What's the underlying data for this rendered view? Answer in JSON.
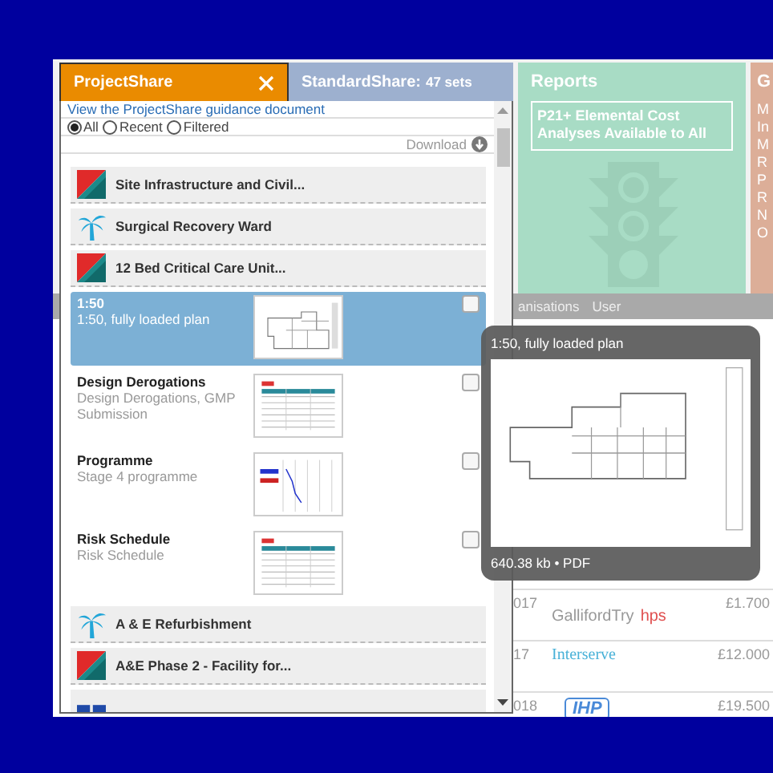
{
  "tabs": [
    {
      "label": "ProjectShare",
      "selected": true,
      "closable": true
    },
    {
      "label": "StandardShare:",
      "count": "47 sets",
      "selected": false,
      "closable": false
    }
  ],
  "guidance_link": "View the ProjectShare guidance document",
  "filters": [
    {
      "label": "All",
      "selected": true
    },
    {
      "label": "Recent",
      "selected": false
    },
    {
      "label": "Filtered",
      "selected": false
    }
  ],
  "download": "Download",
  "entries": [
    {
      "kind": "flag",
      "title": "Site Infrastructure and Civil..."
    },
    {
      "kind": "tree",
      "title": "Surgical Recovery Ward"
    },
    {
      "kind": "flag",
      "title": "12 Bed Critical Care Unit..."
    },
    {
      "kind": "document",
      "title": "1:50",
      "subtitle": "1:50, fully loaded plan",
      "selected": true,
      "checked": false
    },
    {
      "kind": "document",
      "title": "Design Derogations",
      "subtitle": "Design Derogations, GMP Submission",
      "selected": false,
      "checked": false
    },
    {
      "kind": "document",
      "title": "Programme",
      "subtitle": "Stage 4 programme",
      "selected": false,
      "checked": false
    },
    {
      "kind": "document",
      "title": "Risk Schedule",
      "subtitle": "Risk Schedule",
      "selected": false,
      "checked": false
    },
    {
      "kind": "tree",
      "title": "A & E Refurbishment"
    },
    {
      "kind": "flag",
      "title": "A&E Phase 2 - Facility for..."
    },
    {
      "kind": "blocks"
    }
  ],
  "reports": {
    "title": "Reports",
    "notice": "P21+ Elemental Cost Analyses Available to All"
  },
  "side_tile": {
    "title": "G",
    "lines": [
      "M",
      "In",
      "M",
      "R",
      "P",
      "R",
      "N",
      "O"
    ]
  },
  "nav": [
    "anisations",
    "User"
  ],
  "rows": [
    {
      "year": "017",
      "company": "GallifordTry",
      "company_tag": "hps",
      "amount": "£1.700"
    },
    {
      "year": "17",
      "company": "Interserve",
      "amount": "£12.000"
    },
    {
      "year": "018",
      "company": "IHP",
      "amount": "£19.500"
    }
  ],
  "tooltip": {
    "title": "1:50, fully loaded plan",
    "meta": "640.38 kb • PDF"
  }
}
